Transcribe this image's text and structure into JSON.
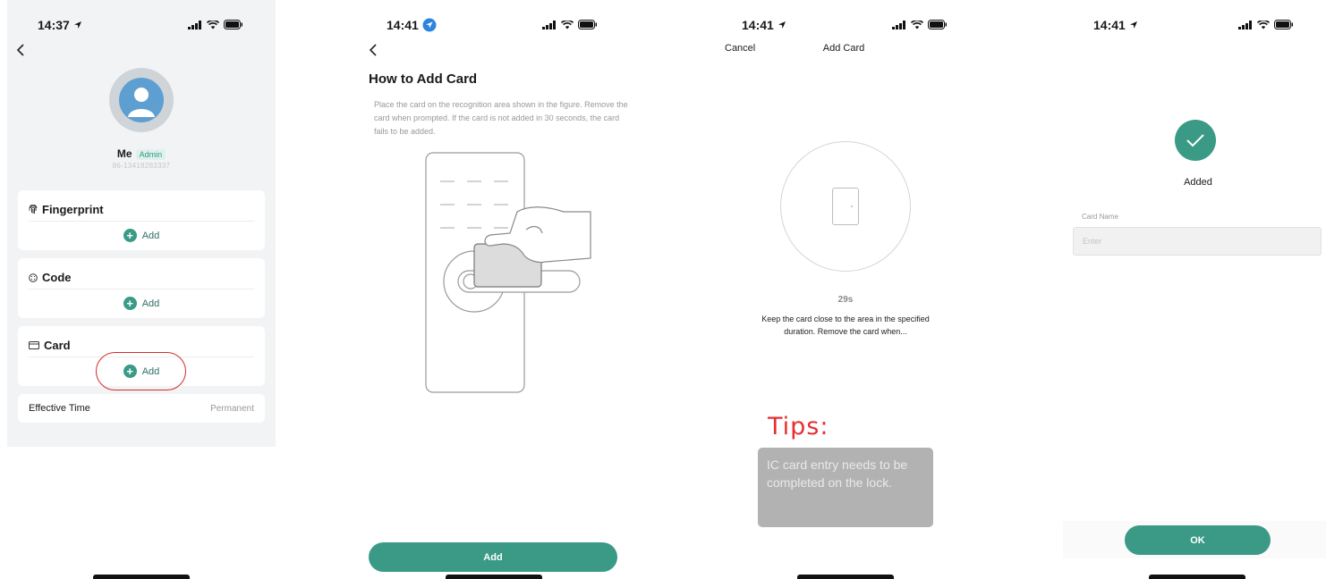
{
  "colors": {
    "accent": "#3a9a86",
    "highlight": "#d42b2b",
    "tips": "#e53030"
  },
  "screen1": {
    "time": "14:37",
    "user": {
      "name": "Me",
      "badge": "Admin",
      "phone": "86-13418283337"
    },
    "sections": [
      {
        "title": "Fingerprint",
        "add_label": "Add",
        "icon": "fingerprint-icon"
      },
      {
        "title": "Code",
        "add_label": "Add",
        "icon": "code-icon"
      },
      {
        "title": "Card",
        "add_label": "Add",
        "icon": "card-icon"
      }
    ],
    "effective_time": {
      "label": "Effective Time",
      "value": "Permanent"
    }
  },
  "screen2": {
    "time": "14:41",
    "title": "How to Add Card",
    "description": "Place the card on the recognition area shown in the figure. Remove the card when prompted. If the card is not added in 30 seconds, the card fails to be added.",
    "button": "Add"
  },
  "screen3": {
    "time": "14:41",
    "cancel": "Cancel",
    "title": "Add Card",
    "timer": "29s",
    "instruction": "Keep the card close to the area in the specified duration. Remove the card when...",
    "tips_title": "Tips:",
    "tips_text": "IC card entry needs to be completed on the lock."
  },
  "screen4": {
    "time": "14:41",
    "status": "Added",
    "field_label": "Card Name",
    "field_placeholder": "Enter",
    "button": "OK"
  }
}
